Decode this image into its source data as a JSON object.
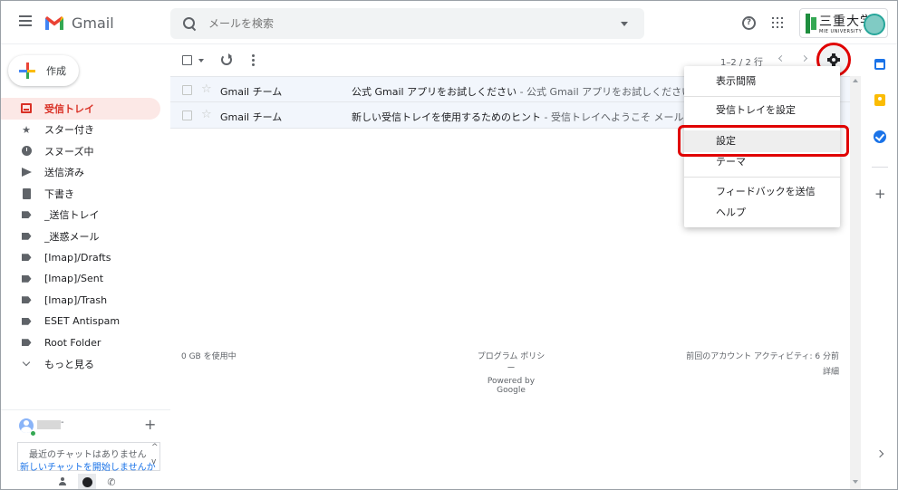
{
  "header": {
    "app_name": "Gmail",
    "search_placeholder": "メールを検索",
    "org_logo_text": "三重大学",
    "org_logo_subtext": "MIE UNIVERSITY"
  },
  "compose": {
    "label": "作成"
  },
  "nav": {
    "items": [
      {
        "label": "受信トレイ",
        "icon": "inbox-icon",
        "active": true
      },
      {
        "label": "スター付き",
        "icon": "star-icon"
      },
      {
        "label": "スヌーズ中",
        "icon": "clock-icon"
      },
      {
        "label": "送信済み",
        "icon": "send-icon"
      },
      {
        "label": "下書き",
        "icon": "draft-icon"
      },
      {
        "label": "_送信トレイ",
        "icon": "label-icon"
      },
      {
        "label": "_迷惑メール",
        "icon": "label-icon"
      },
      {
        "label": "[Imap]/Drafts",
        "icon": "label-icon"
      },
      {
        "label": "[Imap]/Sent",
        "icon": "label-icon"
      },
      {
        "label": "[Imap]/Trash",
        "icon": "label-icon"
      },
      {
        "label": "ESET Antispam",
        "icon": "label-icon"
      },
      {
        "label": "Root Folder",
        "icon": "label-icon"
      },
      {
        "label": "もっと見る",
        "icon": "chevron-down-icon"
      }
    ]
  },
  "chat": {
    "user_suffix": "-",
    "empty_text": "最近のチャットはありません",
    "start_link": "新しいチャットを開始しませんか"
  },
  "toolbar": {
    "pager_text": "1–2 / 2 行"
  },
  "emails": [
    {
      "sender": "Gmail チーム",
      "subject": "公式 Gmail アプリをお試しください",
      "snippet": " - 公式 Gmail アプリをお試しください 三重大"
    },
    {
      "sender": "Gmail チーム",
      "subject": "新しい受信トレイを使用するためのヒント",
      "snippet": " - 受信トレイへようこそ メールをすば"
    }
  ],
  "settings_menu": {
    "items": [
      {
        "label": "表示間隔"
      },
      {
        "label": "受信トレイを設定"
      },
      {
        "label": "設定"
      },
      {
        "label": "テーマ"
      },
      {
        "label": "フィードバックを送信"
      },
      {
        "label": "ヘルプ"
      }
    ]
  },
  "footer": {
    "storage": "0 GB を使用中",
    "program_policy": "プログラム ポリシー",
    "powered_by": "Powered by Google",
    "last_activity": "前回のアカウント アクティビティ: 6 分前",
    "details": "詳細"
  },
  "colors": {
    "highlight_red": "#e00000",
    "active_nav_bg": "#fce8e6",
    "active_nav_text": "#d93025",
    "link_blue": "#1a73e8"
  }
}
